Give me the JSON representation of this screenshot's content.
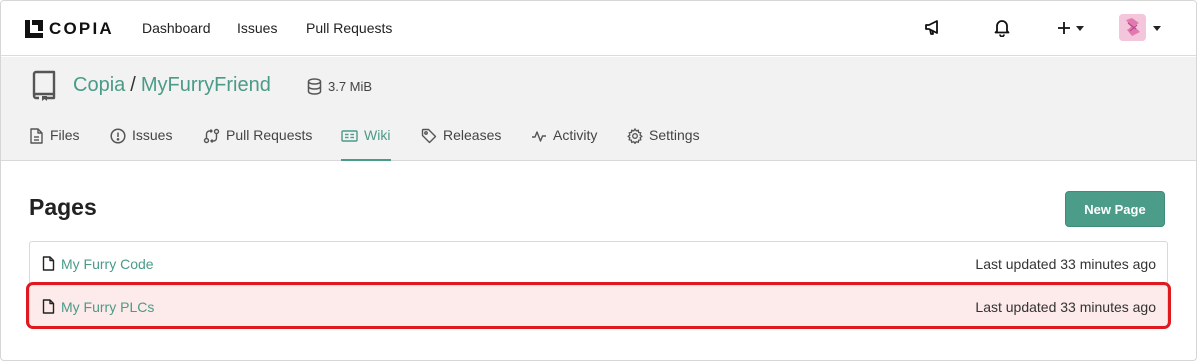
{
  "brand": {
    "name": "COPIA"
  },
  "topnav": {
    "links": [
      "Dashboard",
      "Issues",
      "Pull Requests"
    ],
    "icons": [
      "megaphone-icon",
      "bell-icon",
      "plus-icon",
      "avatar"
    ]
  },
  "repo": {
    "owner": "Copia",
    "separator": "/",
    "name": "MyFurryFriend",
    "size": "3.7 MiB"
  },
  "tabs": [
    {
      "label": "Files",
      "icon": "file-icon"
    },
    {
      "label": "Issues",
      "icon": "alert-circle-icon"
    },
    {
      "label": "Pull Requests",
      "icon": "pull-request-icon"
    },
    {
      "label": "Wiki",
      "icon": "book-icon",
      "active": true
    },
    {
      "label": "Releases",
      "icon": "tag-icon"
    },
    {
      "label": "Activity",
      "icon": "pulse-icon"
    },
    {
      "label": "Settings",
      "icon": "gear-icon"
    }
  ],
  "wiki": {
    "heading": "Pages",
    "new_button": "New Page",
    "pages": [
      {
        "title": "My Furry Code",
        "updated": "Last updated 33 minutes ago"
      },
      {
        "title": "My Furry PLCs",
        "updated": "Last updated 33 minutes ago",
        "highlighted": true
      }
    ]
  },
  "colors": {
    "accent": "#4a9b88",
    "highlight_border": "#e0191e",
    "highlight_fill": "#fdeaea"
  }
}
